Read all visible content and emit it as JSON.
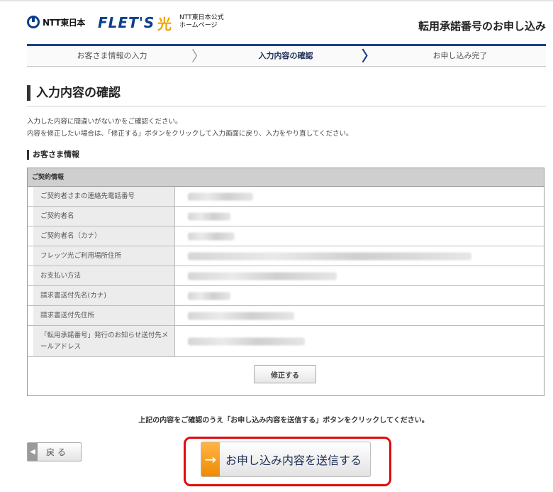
{
  "header": {
    "ntt_logo_text": "NTT東日本",
    "flets_logo_text": "FLET'S",
    "hikari_text": "光",
    "corp_line1": "NTT東日本公式",
    "corp_line2": "ホームページ",
    "page_title": "転用承諾番号のお申し込み"
  },
  "steps": [
    {
      "label": "お客さま情報の入力"
    },
    {
      "label": "入力内容の確認",
      "current": true
    },
    {
      "label": "お申し込み完了"
    }
  ],
  "section": {
    "heading": "入力内容の確認",
    "intro_line1": "入力した内容に間違いがないかをご確認ください。",
    "intro_line2": "内容を修正したい場合は、「修正する」ボタンをクリックして入力画面に戻り、入力をやり直してください。"
  },
  "customer": {
    "heading": "お客さま情報",
    "table_header": "ご契約情報",
    "rows": [
      {
        "label": "ご契約者さまの連絡先電話番号"
      },
      {
        "label": "ご契約者名"
      },
      {
        "label": "ご契約者名（カナ）"
      },
      {
        "label": "フレッツ光ご利用場所住所"
      },
      {
        "label": "お支払い方法"
      },
      {
        "label": "請求書送付先名(カナ)"
      },
      {
        "label": "請求書送付先住所"
      },
      {
        "label": "「転用承諾番号」発行のお知らせ送付先メールアドレス"
      }
    ],
    "fix_button": "修正する"
  },
  "confirm_text": "上記の内容をご確認のうえ「お申し込み内容を送信する」ボタンをクリックしてください。",
  "back_button": "戻 る",
  "submit_button": "お申し込み内容を送信する",
  "colors": {
    "brand_blue": "#1a3f85",
    "accent_orange": "#f08a00",
    "highlight_red": "#e00b0b"
  }
}
